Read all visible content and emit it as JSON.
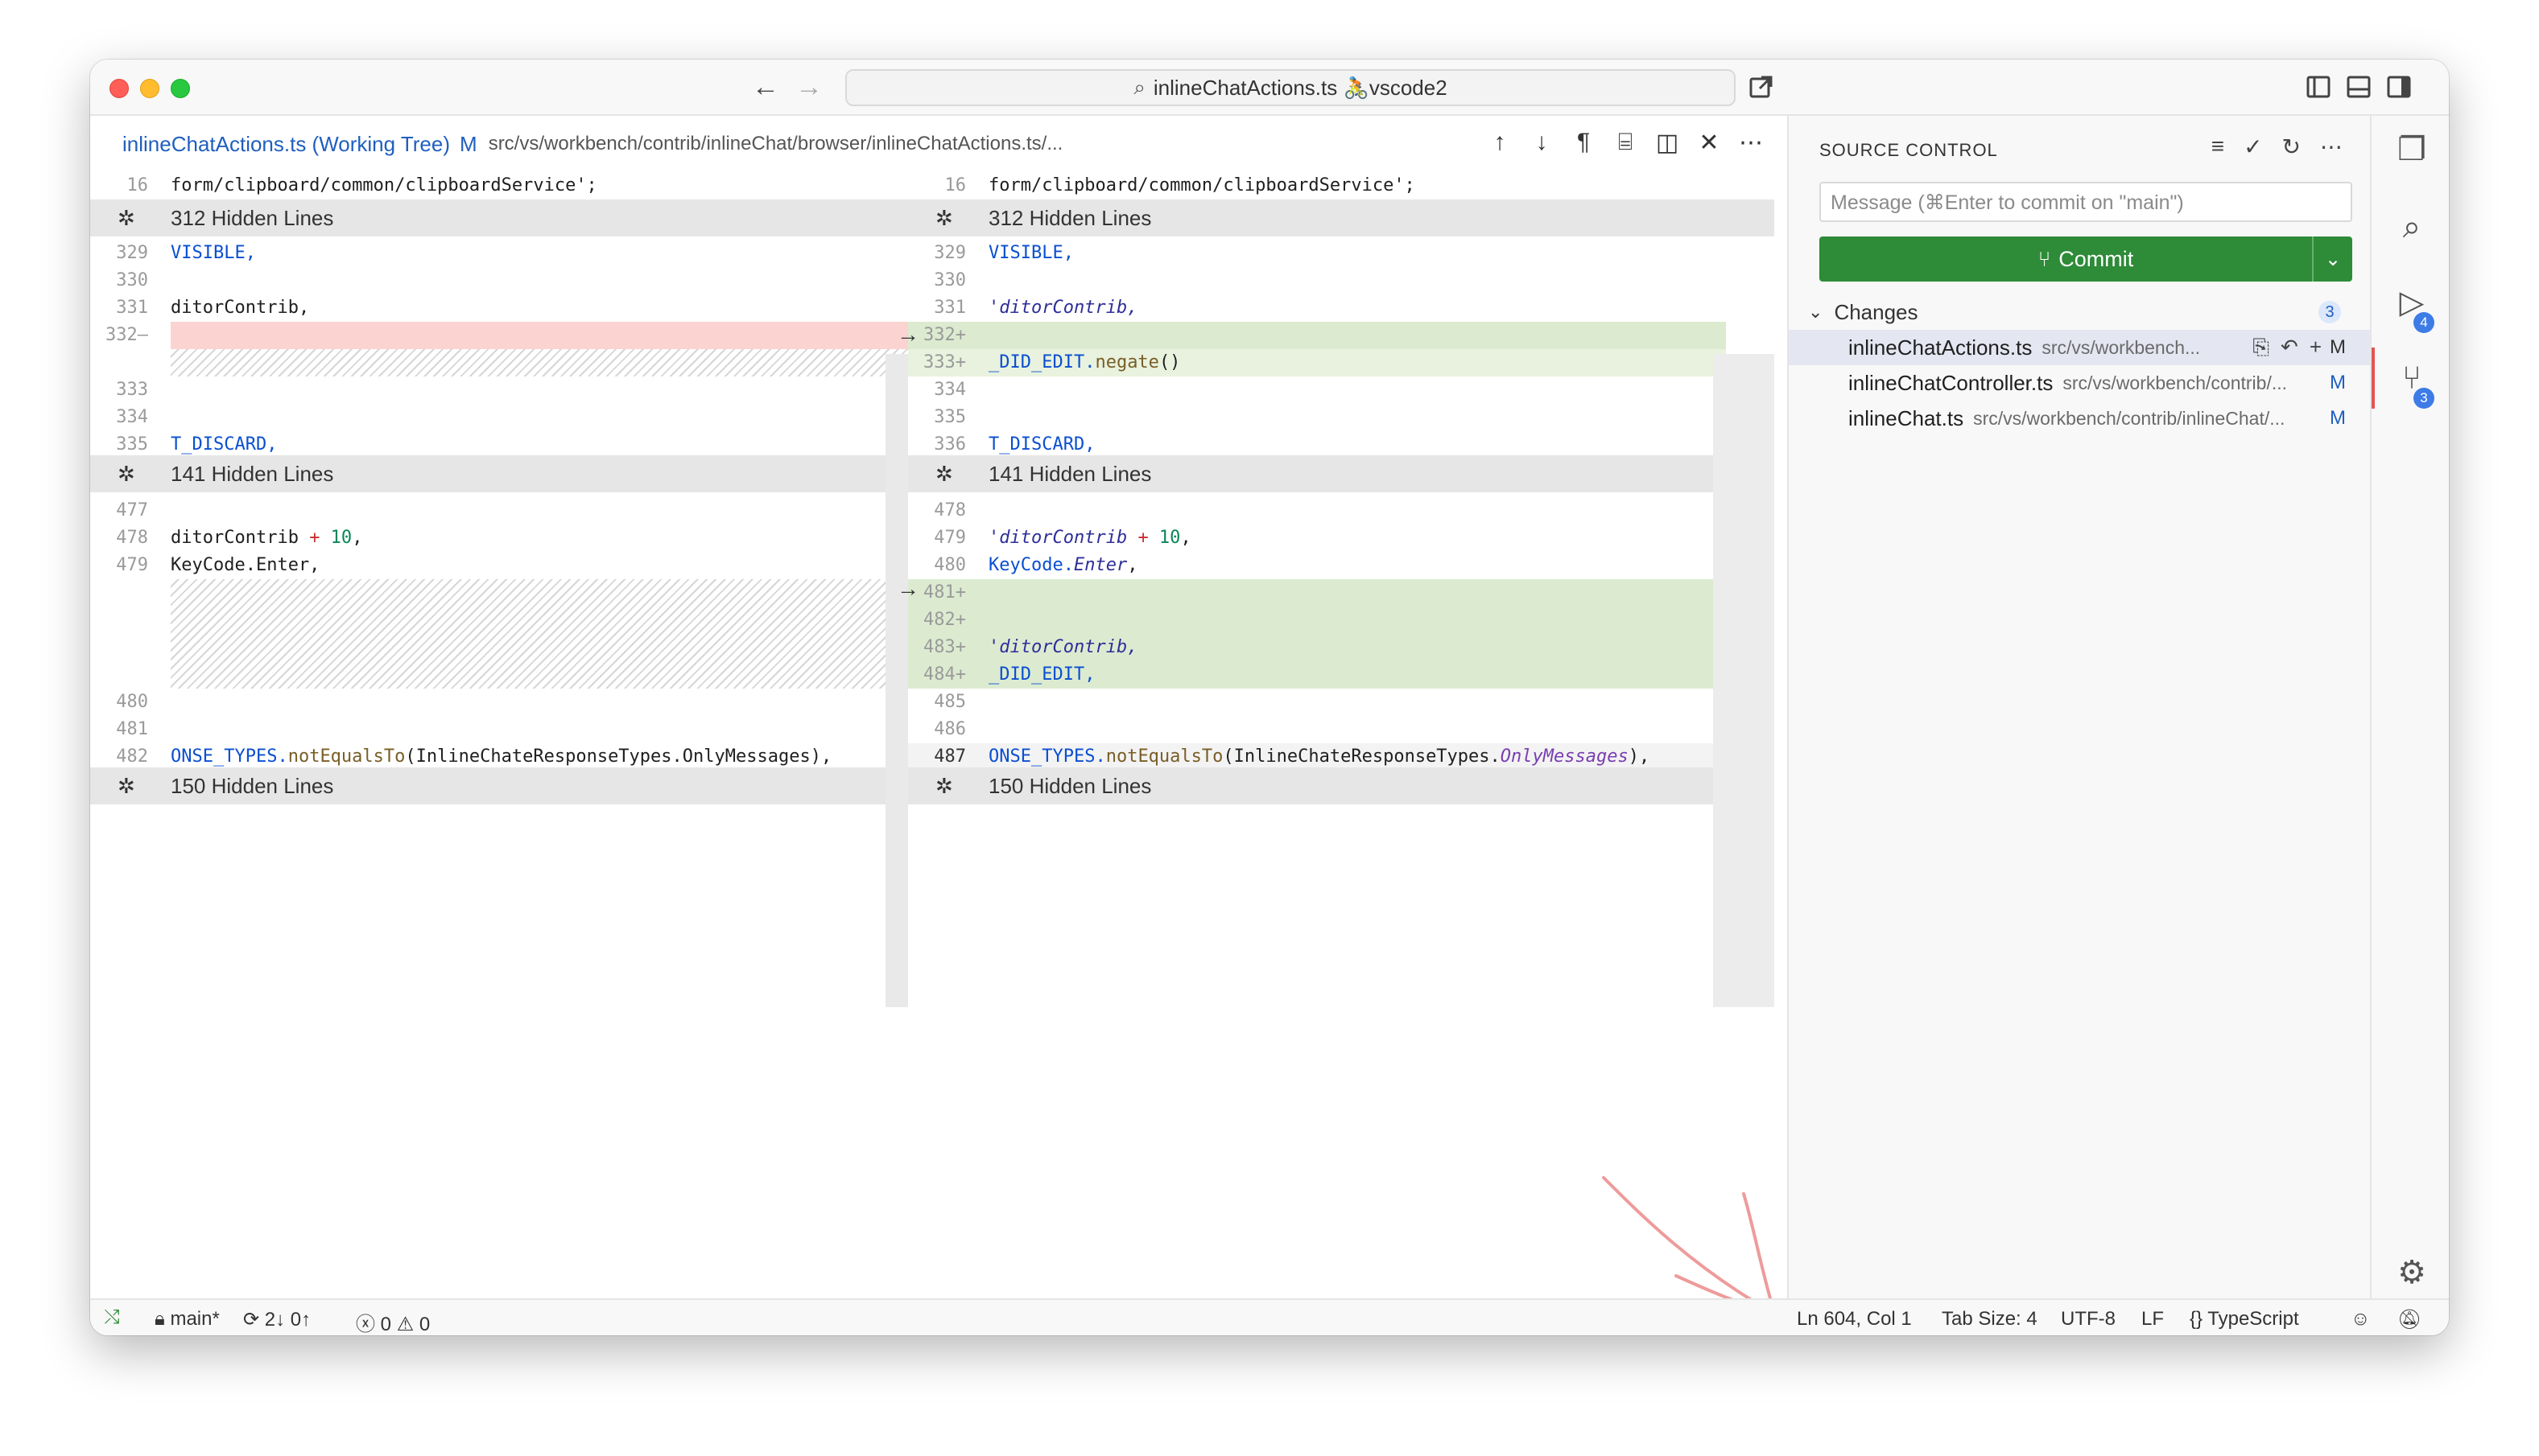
{
  "window": {
    "title_search": "inlineChatActions.ts 🚴vscode2"
  },
  "editor": {
    "tab_title": "inlineChatActions.ts (Working Tree)",
    "tab_status": "M",
    "tab_path": "src/vs/workbench/contrib/inlineChat/browser/inlineChatActions.ts/..."
  },
  "left": {
    "lines": [
      {
        "ln": "16",
        "code": "form/clipboard/common/clipboardService';"
      },
      {
        "hidden": "312 Hidden Lines"
      },
      {
        "ln": "329",
        "code": "VISIBLE,"
      },
      {
        "ln": "330",
        "code": ""
      },
      {
        "ln": "331",
        "code": "ditorContrib,"
      },
      {
        "ln": "332—",
        "code": ""
      },
      {
        "ln": "333",
        "code": ""
      },
      {
        "ln": "334",
        "code": ""
      },
      {
        "ln": "335",
        "code": "T_DISCARD,"
      },
      {
        "hidden": "141 Hidden Lines"
      },
      {
        "ln": "477",
        "code": ""
      },
      {
        "ln": "478",
        "code_a": "ditorContrib ",
        "code_op": "+",
        "code_num": " 10",
        "code_b": ","
      },
      {
        "ln": "479",
        "code": "KeyCode.Enter,"
      },
      {
        "ln": "480",
        "code": ""
      },
      {
        "ln": "481",
        "code": ""
      },
      {
        "ln": "482",
        "code_a": "ONSE_TYPES.",
        "code_fn": "notEqualsTo",
        "code_b": "(InlineChateResponseTypes.OnlyMessages),"
      },
      {
        "hidden": "150 Hidden Lines"
      }
    ]
  },
  "right": {
    "lines": [
      {
        "ln": "16",
        "code": "form/clipboard/common/clipboardService';"
      },
      {
        "hidden": "312 Hidden Lines"
      },
      {
        "ln": "329",
        "code": "VISIBLE,"
      },
      {
        "ln": "330",
        "code": ""
      },
      {
        "ln": "331",
        "code": "'ditorContrib,"
      },
      {
        "ln": "332+",
        "code": ""
      },
      {
        "ln": "333+",
        "code_a": "_DID_EDIT.",
        "code_fn": "negate",
        "code_b": "()"
      },
      {
        "ln": "334",
        "code": ""
      },
      {
        "ln": "335",
        "code": ""
      },
      {
        "ln": "336",
        "code": "T_DISCARD,"
      },
      {
        "hidden": "141 Hidden Lines"
      },
      {
        "ln": "478",
        "code": ""
      },
      {
        "ln": "479",
        "code_a": "'ditorContrib ",
        "code_op": "+",
        "code_num": " 10",
        "code_b": ","
      },
      {
        "ln": "480",
        "code_a": "KeyCode.",
        "code_it": "Enter",
        "code_b": ","
      },
      {
        "ln": "481+",
        "code": ""
      },
      {
        "ln": "482+",
        "code": ""
      },
      {
        "ln": "483+",
        "code": "'ditorContrib,"
      },
      {
        "ln": "484+",
        "code": "_DID_EDIT,"
      },
      {
        "ln": "485",
        "code": ""
      },
      {
        "ln": "486",
        "code": ""
      },
      {
        "ln": "487",
        "code_a": "ONSE_TYPES.",
        "code_fn": "notEqualsTo",
        "code_b": "(InlineChateResponseTypes.",
        "code_it": "OnlyMessages",
        "code_c": "),"
      },
      {
        "hidden": "150 Hidden Lines"
      }
    ]
  },
  "source_control": {
    "header": "SOURCE CONTROL",
    "message_placeholder": "Message (⌘Enter to commit on \"main\")",
    "commit_label": "Commit",
    "changes_label": "Changes",
    "changes_count": "3",
    "files": [
      {
        "name": "inlineChatActions.ts",
        "path": "src/vs/workbench...",
        "status": "M"
      },
      {
        "name": "inlineChatController.ts",
        "path": "src/vs/workbench/contrib/...",
        "status": "M"
      },
      {
        "name": "inlineChat.ts",
        "path": "src/vs/workbench/contrib/inlineChat/...",
        "status": "M"
      }
    ]
  },
  "activity": {
    "debug_badge": "4",
    "scm_badge": "3"
  },
  "status": {
    "branch": "main*",
    "sync": "2↓ 0↑",
    "errors": "0",
    "warnings": "0",
    "position": "Ln 604, Col 1",
    "tab_size": "Tab Size: 4",
    "encoding": "UTF-8",
    "eol": "LF",
    "language": "TypeScript"
  },
  "colors": {
    "accent": "#1f5fbf",
    "commit_button": "#2e8b38",
    "deleted_bg": "#fbd3d0",
    "inserted_bg": "#dcebd0"
  }
}
